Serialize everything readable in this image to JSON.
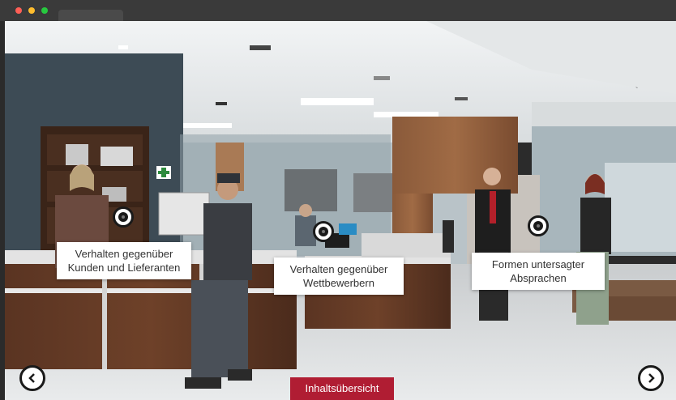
{
  "window": {
    "controls": [
      {
        "name": "close",
        "color": "#ff5f56"
      },
      {
        "name": "minimize",
        "color": "#ffbd2e"
      },
      {
        "name": "zoom",
        "color": "#27c93f"
      }
    ]
  },
  "hotspots": [
    {
      "id": "customers",
      "label": "Verhalten gegenüber\nKunden und Lieferanten"
    },
    {
      "id": "competitors",
      "label": "Verhalten gegenüber\nWettbewerbern"
    },
    {
      "id": "agreements",
      "label": "Formen untersagter\nAbsprachen"
    }
  ],
  "navigation": {
    "prev_icon": "chevron-left-icon",
    "next_icon": "chevron-right-icon",
    "toc_label": "Inhaltsübersicht"
  },
  "colors": {
    "accent": "#b01d33",
    "label_bg": "#ffffff",
    "hotspot_ring": "#1a1a1a"
  }
}
